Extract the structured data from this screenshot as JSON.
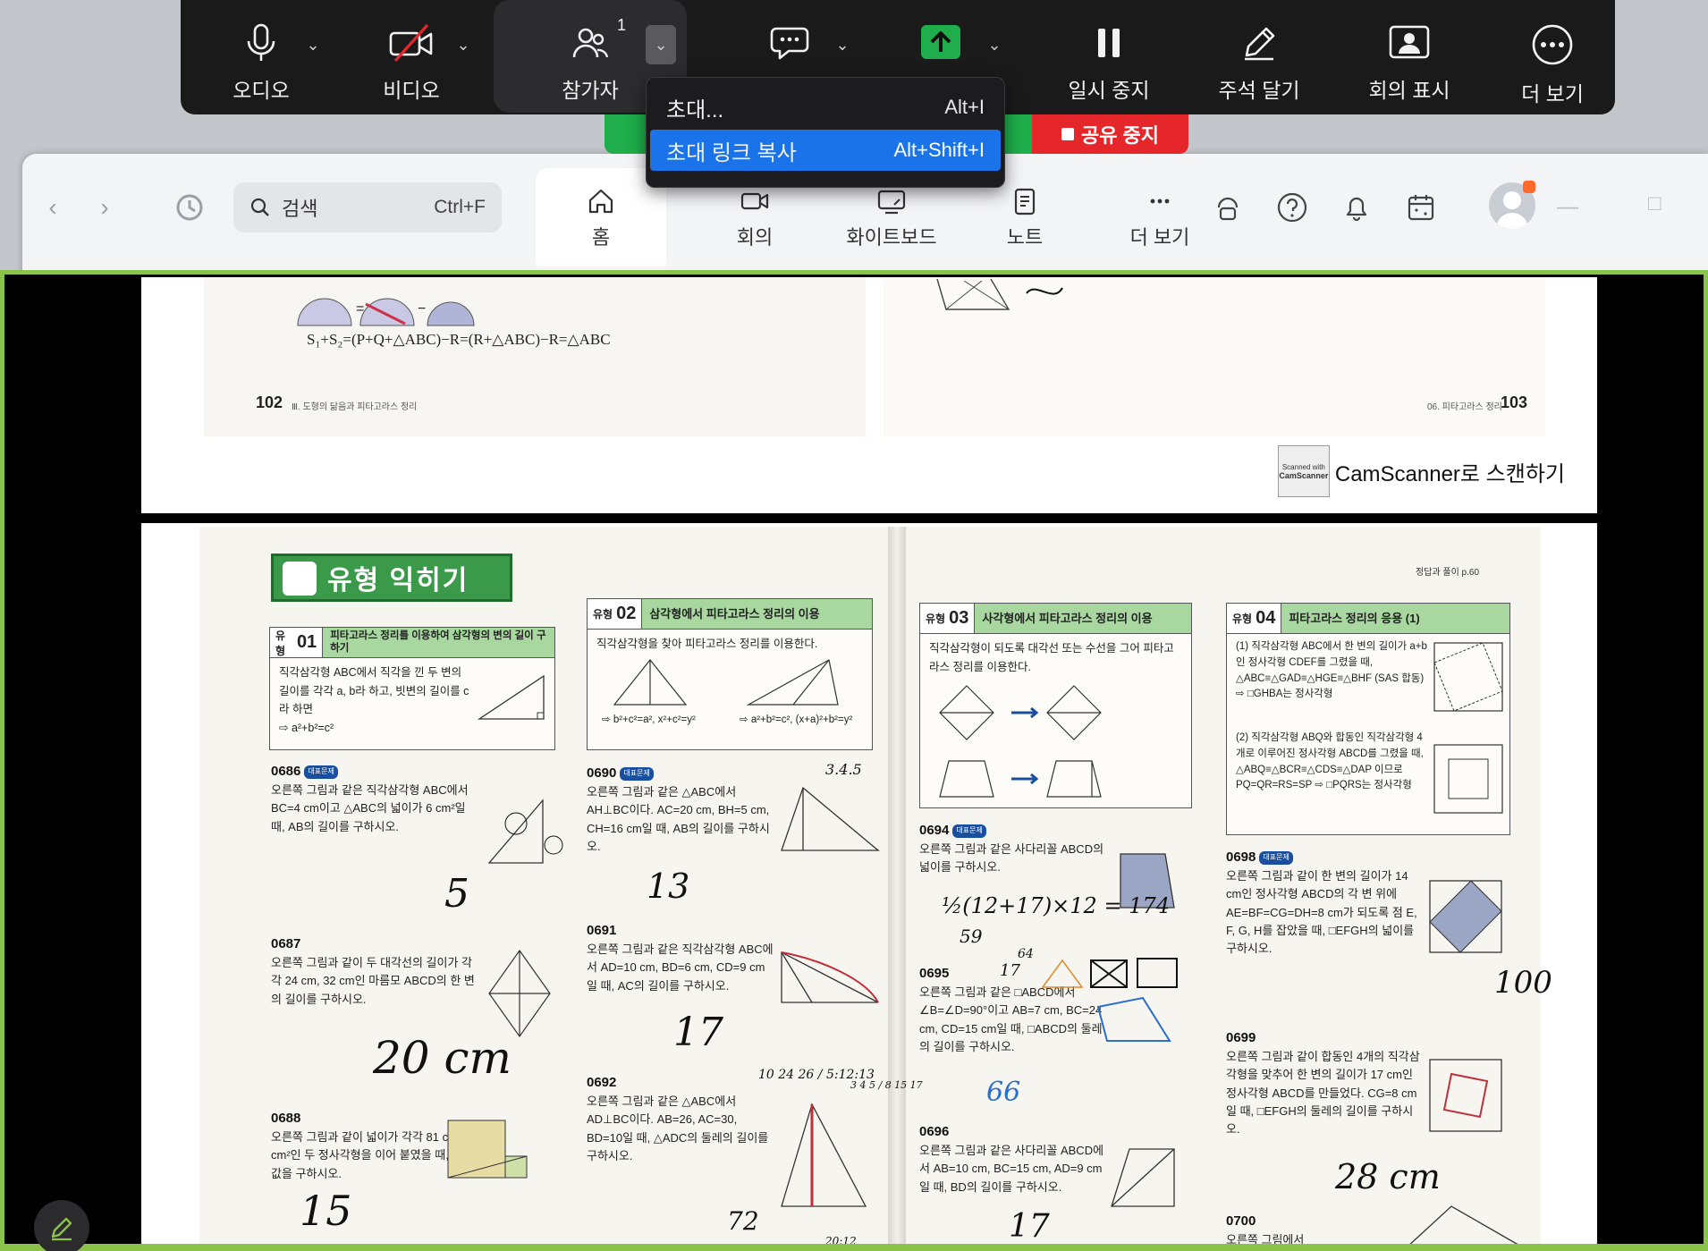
{
  "meeting_toolbar": {
    "audio": {
      "label": "오디오",
      "icon": "microphone-icon"
    },
    "video": {
      "label": "비디오",
      "icon": "video-off-icon"
    },
    "participants": {
      "label": "참가자",
      "count": "1",
      "icon": "participants-icon"
    },
    "chat": {
      "icon": "chat-icon"
    },
    "share": {
      "icon": "share-screen-icon",
      "color": "#1fae4b"
    },
    "pause": {
      "label": "일시 중지",
      "icon": "pause-icon"
    },
    "annotate": {
      "label": "주석 달기",
      "icon": "pencil-icon"
    },
    "show_meeting": {
      "label": "회의 표시",
      "icon": "meeting-window-icon"
    },
    "more": {
      "label": "더 보기",
      "icon": "more-icon"
    }
  },
  "participants_menu": {
    "items": [
      {
        "label": "초대...",
        "shortcut": "Alt+I",
        "selected": false
      },
      {
        "label": "초대 링크 복사",
        "shortcut": "Alt+Shift+I",
        "selected": true
      }
    ]
  },
  "share_status": {
    "stop_label": "공유 중지",
    "stop_color": "#e5262b"
  },
  "app": {
    "search": {
      "label": "검색",
      "shortcut": "Ctrl+F"
    },
    "tabs": [
      {
        "label": "홈",
        "icon": "home-icon",
        "active": true
      },
      {
        "label": "회의",
        "icon": "video-camera-icon",
        "active": false
      },
      {
        "label": "화이트보드",
        "icon": "whiteboard-icon",
        "active": false
      },
      {
        "label": "노트",
        "icon": "notes-icon",
        "active": false
      },
      {
        "label": "더 보기",
        "icon": "more-horizontal-icon",
        "active": false
      }
    ]
  },
  "shared_content": {
    "frame_color": "#8bc34a",
    "top_page": {
      "formula": "S₁+S₂=(P+Q+△ABC)−R=(R+△ABC)−R=△ABC",
      "left_page_number": "102",
      "left_page_title": "Ⅲ. 도형의 닮음과 피타고라스 정리",
      "right_page_title": "06. 피타고라스 정리",
      "right_page_number": "103",
      "scanner_badge_line1": "Scanned with",
      "scanner_badge_line2": "CamScanner",
      "scanner_text": "CamScanner로 스캔하기"
    },
    "main_page": {
      "banner_title": "유형 익히기",
      "answer_ref": "정답과 풀이 p.60",
      "type01": {
        "tag": "유형",
        "num": "01",
        "title": "피타고라스 정리를 이용하여 삼각형의 변의 길이 구하기",
        "body": "직각삼각형 ABC에서 직각을 낀 두 변의 길이를 각각 a, b라 하고, 빗변의 길이를 c라 하면",
        "formula": "⇨ a²+b²=c²"
      },
      "type02": {
        "tag": "유형",
        "num": "02",
        "title": "삼각형에서 피타고라스 정리의 이용",
        "body": "직각삼각형을 찾아 피타고라스 정리를 이용한다.",
        "f1": "⇨ b²+c²=a², x²+c²=y²",
        "f2": "⇨ a²+b²=c², (x+a)²+b²=y²"
      },
      "type03": {
        "tag": "유형",
        "num": "03",
        "title": "사각형에서 피타고라스 정리의 이용",
        "body": "직각삼각형이 되도록 대각선 또는 수선을 그어 피타고라스 정리를 이용한다."
      },
      "type04": {
        "tag": "유형",
        "num": "04",
        "title": "피타고라스 정리의 응용 (1)",
        "body1": "(1) 직각삼각형 ABC에서 한 변의 길이가 a+b인 정사각형 CDEF를 그렸을 때, △ABC≡△GAD≡△HGE≡△BHF (SAS 합동) ⇨ □GHBA는 정사각형",
        "body2": "(2) 직각삼각형 ABQ와 합동인 직각삼각형 4개로 이루어진 정사각형 ABCD를 그렸을 때, △ABQ≡△BCR≡△CDS≡△DAP 이므로 PQ=QR=RS=SP ⇨ □PQRS는 정사각형"
      },
      "problems": [
        {
          "num": "0686",
          "text": "오른쪽 그림과 같은 직각삼각형 ABC에서 BC=4 cm이고 △ABC의 넓이가 6 cm²일 때, AB의 길이를 구하시오.",
          "answer": "5"
        },
        {
          "num": "0687",
          "text": "오른쪽 그림과 같이 두 대각선의 길이가 각각 24 cm, 32 cm인 마름모 ABCD의 한 변의 길이를 구하시오.",
          "answer": "20 cm"
        },
        {
          "num": "0688",
          "text": "오른쪽 그림과 같이 넓이가 각각 81 cm², 9 cm²인 두 정사각형을 이어 붙였을 때, x의 값을 구하시오.",
          "answer": "15"
        },
        {
          "num": "0690",
          "text": "오른쪽 그림과 같은 △ABC에서 AH⊥BC이다. AC=20 cm, BH=5 cm, CH=16 cm일 때, AB의 길이를 구하시오.",
          "answer": "13"
        },
        {
          "num": "0691",
          "text": "오른쪽 그림과 같은 직각삼각형 ABC에서 AD=10 cm, BD=6 cm, CD=9 cm일 때, AC의 길이를 구하시오.",
          "answer": "17"
        },
        {
          "num": "0692",
          "text": "오른쪽 그림과 같은 △ABC에서 AD⊥BC이다. AB=26, AC=30, BD=10일 때, △ADC의 둘레의 길이를 구하시오.",
          "answer": "72"
        },
        {
          "num": "0694",
          "text": "오른쪽 그림과 같은 사다리꼴 ABCD의 넓이를 구하시오.",
          "answer": "½(12+17)×12 = 174"
        },
        {
          "num": "0695",
          "text": "오른쪽 그림과 같은 □ABCD에서 ∠B=∠D=90°이고 AB=7 cm, BC=24 cm, CD=15 cm일 때, □ABCD의 둘레의 길이를 구하시오.",
          "answer": "66"
        },
        {
          "num": "0696",
          "text": "오른쪽 그림과 같은 사다리꼴 ABCD에서 AB=10 cm, BC=15 cm, AD=9 cm일 때, BD의 길이를 구하시오.",
          "answer": "17"
        },
        {
          "num": "0698",
          "text": "오른쪽 그림과 같이 한 변의 길이가 14 cm인 정사각형 ABCD의 각 변 위에 AE=BF=CG=DH=8 cm가 되도록 점 E, F, G, H를 잡았을 때, □EFGH의 넓이를 구하시오.",
          "answer": "100"
        },
        {
          "num": "0699",
          "text": "오른쪽 그림과 같이 합동인 4개의 직각삼각형을 맞추어 한 변의 길이가 17 cm인 정사각형 ABCD를 만들었다. CG=8 cm일 때, □EFGH의 둘레의 길이를 구하시오.",
          "answer": "28 cm"
        },
        {
          "num": "0700",
          "text": "오른쪽 그림에서",
          "answer": ""
        }
      ],
      "handwriting": {
        "n0690_side": "3.4.5",
        "n0692_side": "10 24 26 / 5:12:13",
        "n0692_side2": "3 4 5 / 8 15 17",
        "n0694_work": "59",
        "n0695_num": "17",
        "n0695_num2": "64",
        "bottom_time": "20:12"
      }
    }
  }
}
